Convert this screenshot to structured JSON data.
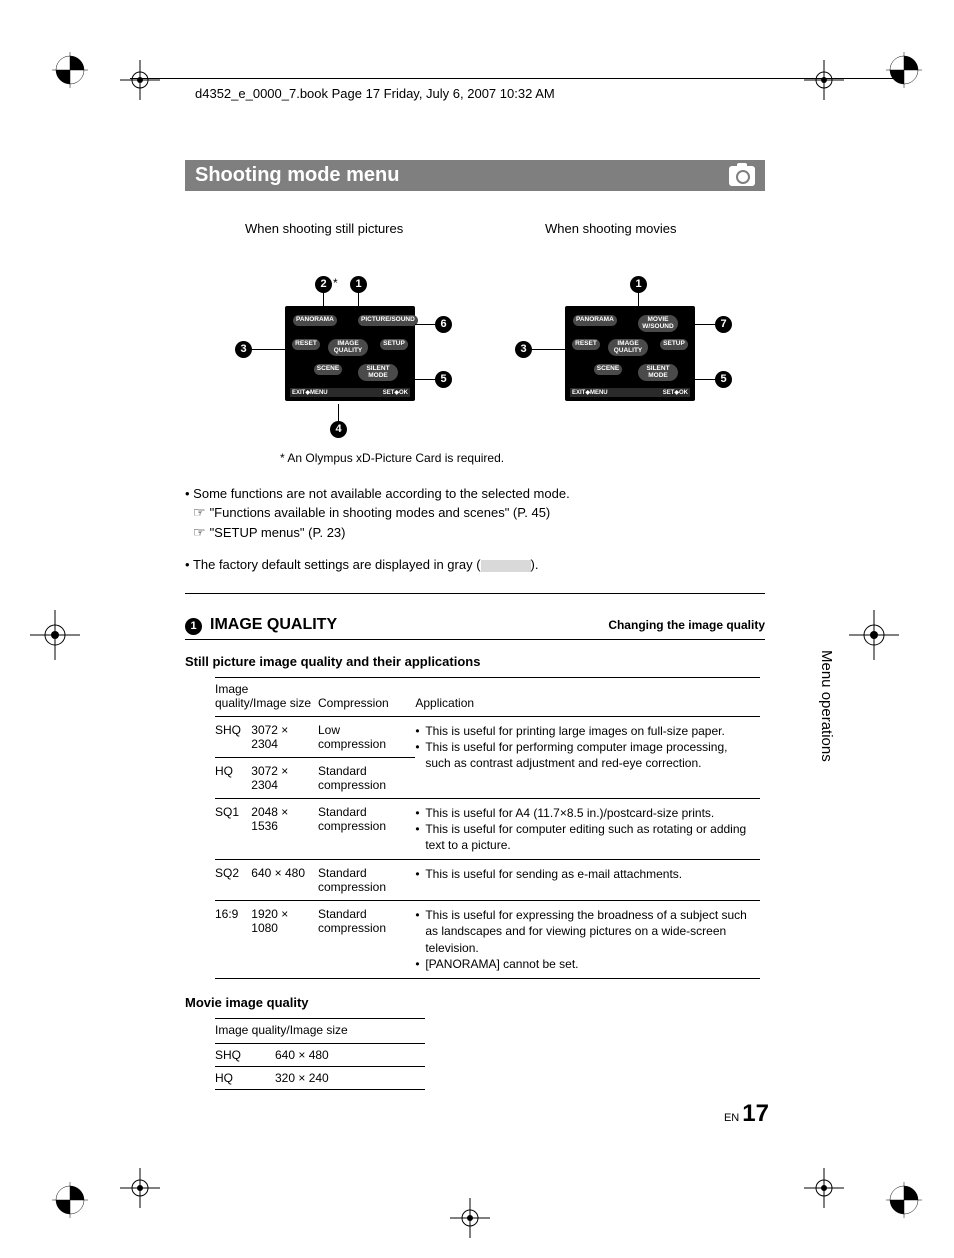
{
  "header": "d4352_e_0000_7.book  Page 17  Friday, July 6, 2007  10:32 AM",
  "title": "Shooting mode menu",
  "diagrams": {
    "still_caption": "When shooting still pictures",
    "movie_caption": "When shooting movies",
    "menu_items": {
      "panorama": "PANORAMA",
      "picture_sound": "PICTURE/SOUND",
      "movie_sound": "MOVIE W/SOUND",
      "reset": "RESET",
      "image_quality": "IMAGE QUALITY",
      "setup": "SETUP",
      "scene": "SCENE",
      "silent": "SILENT MODE",
      "exit": "EXIT",
      "menu": "MENU",
      "set": "SET",
      "ok": "OK"
    },
    "callouts": [
      "1",
      "2",
      "3",
      "4",
      "5",
      "6",
      "7"
    ]
  },
  "footnote": "*  An Olympus xD-Picture Card is required.",
  "notes": {
    "n1": "Some functions are not available according to the selected mode.",
    "ref1": "\"Functions available in shooting modes and scenes\" (P. 45)",
    "ref2": "\"SETUP menus\" (P. 23)",
    "n2a": "The factory default settings are displayed in gray (",
    "n2b": ")."
  },
  "section": {
    "num": "1",
    "title": "IMAGE QUALITY",
    "subtitle": "Changing the image quality"
  },
  "still": {
    "heading": "Still picture image quality and their applications",
    "headers": {
      "h1": "Image quality/Image size",
      "h2": "Compression",
      "h3": "Application"
    },
    "rows": [
      {
        "q": "SHQ",
        "s": "3072 × 2304",
        "c": "Low compression"
      },
      {
        "q": "HQ",
        "s": "3072 × 2304",
        "c": "Standard compression"
      },
      {
        "q": "SQ1",
        "s": "2048 × 1536",
        "c": "Standard compression"
      },
      {
        "q": "SQ2",
        "s": "640 × 480",
        "c": "Standard compression"
      },
      {
        "q": "16:9",
        "s": "1920 × 1080",
        "c": "Standard compression"
      }
    ],
    "apps": {
      "a12_1": "This is useful for printing large images on full-size paper.",
      "a12_2": "This is useful for performing computer image processing, such as contrast adjustment and red-eye correction.",
      "a3_1": "This is useful for A4 (11.7×8.5 in.)/postcard-size prints.",
      "a3_2": "This is useful for computer editing such as rotating or adding text to a picture.",
      "a4_1": "This is useful for sending as e-mail attachments.",
      "a5_1": "This is useful for expressing the broadness of a subject such as landscapes and for viewing pictures on a wide-screen television.",
      "a5_2": "[PANORAMA] cannot be set."
    }
  },
  "movie": {
    "heading": "Movie image quality",
    "header": "Image quality/Image size",
    "rows": [
      {
        "q": "SHQ",
        "s": "640 × 480"
      },
      {
        "q": "HQ",
        "s": "320 × 240"
      }
    ]
  },
  "side_tab": "Menu operations",
  "page": {
    "prefix": "EN",
    "num": "17"
  }
}
